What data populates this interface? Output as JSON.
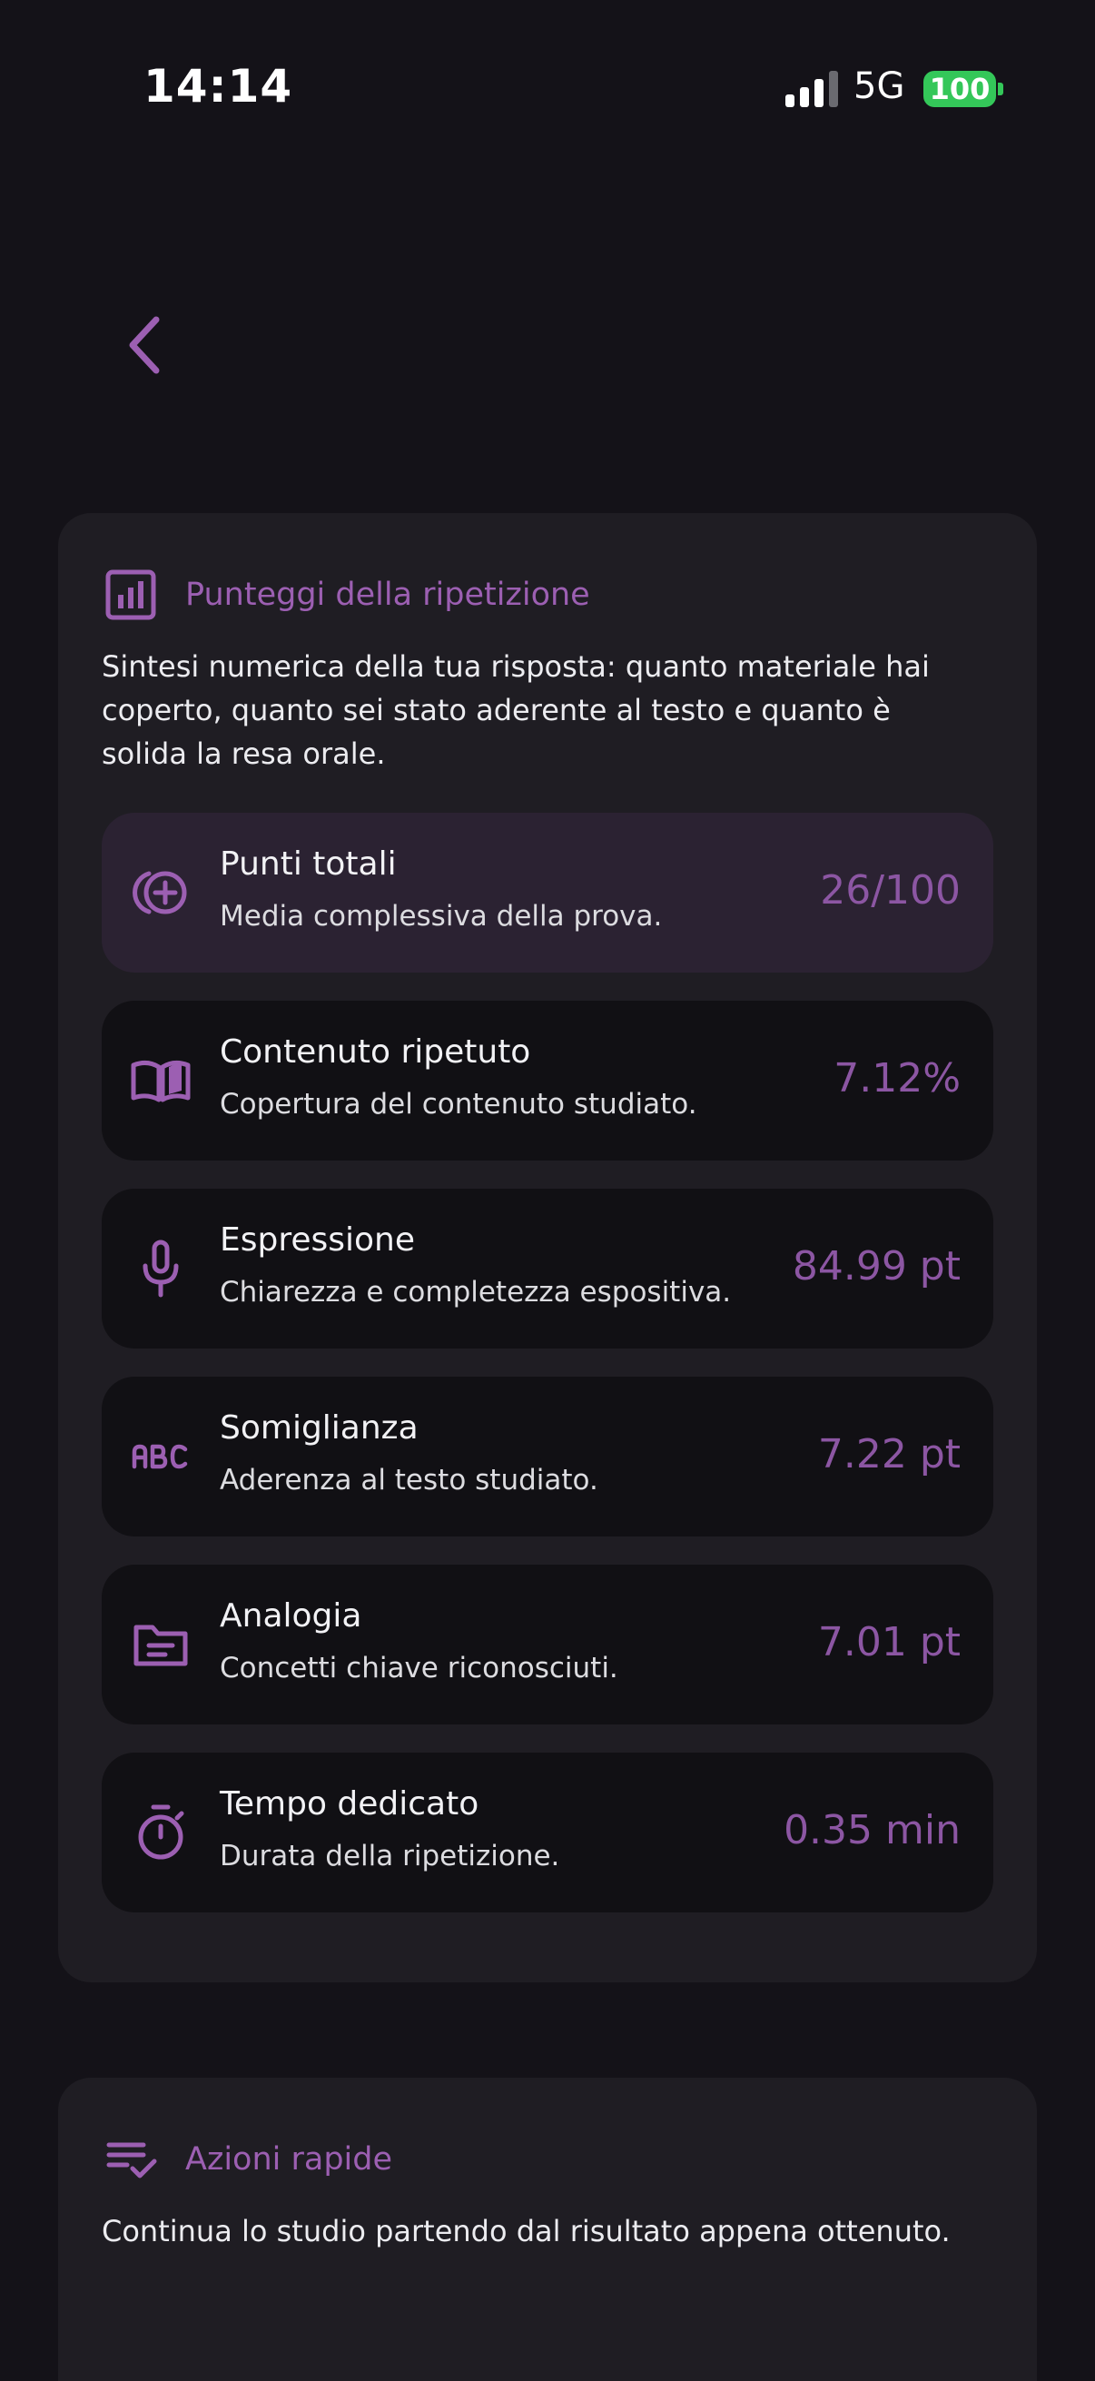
{
  "status_bar": {
    "time": "14:14",
    "network": "5G",
    "battery": "100"
  },
  "colors": {
    "background": "#141218",
    "card": "#1f1d23",
    "row": "#111014",
    "highlight_row": "#2b2232",
    "accent": "#9c5fb2",
    "battery": "#34c759"
  },
  "scores_card": {
    "icon": "bar-chart-icon",
    "title": "Punteggi della ripetizione",
    "description": "Sintesi numerica della tua risposta: quanto materiale hai coperto, quanto sei stato aderente al testo e quanto è solida la resa orale.",
    "rows": [
      {
        "icon": "add-circle-icon",
        "title": "Punti totali",
        "subtitle": "Media complessiva della prova.",
        "value": "26/100"
      },
      {
        "icon": "open-book-icon",
        "title": "Contenuto ripetuto",
        "subtitle": "Copertura del contenuto studiato.",
        "value": "7.12%"
      },
      {
        "icon": "microphone-icon",
        "title": "Espressione",
        "subtitle": "Chiarezza e completezza espositiva.",
        "value": "84.99 pt"
      },
      {
        "icon": "abc-icon",
        "title": "Somiglianza",
        "subtitle": "Aderenza al testo studiato.",
        "value": "7.22 pt"
      },
      {
        "icon": "folder-icon",
        "title": "Analogia",
        "subtitle": "Concetti chiave riconosciuti.",
        "value": "7.01 pt"
      },
      {
        "icon": "stopwatch-icon",
        "title": "Tempo dedicato",
        "subtitle": "Durata della ripetizione.",
        "value": "0.35 min"
      }
    ]
  },
  "actions_card": {
    "icon": "checklist-icon",
    "title": "Azioni rapide",
    "description": "Continua lo studio partendo dal risultato appena ottenuto."
  }
}
